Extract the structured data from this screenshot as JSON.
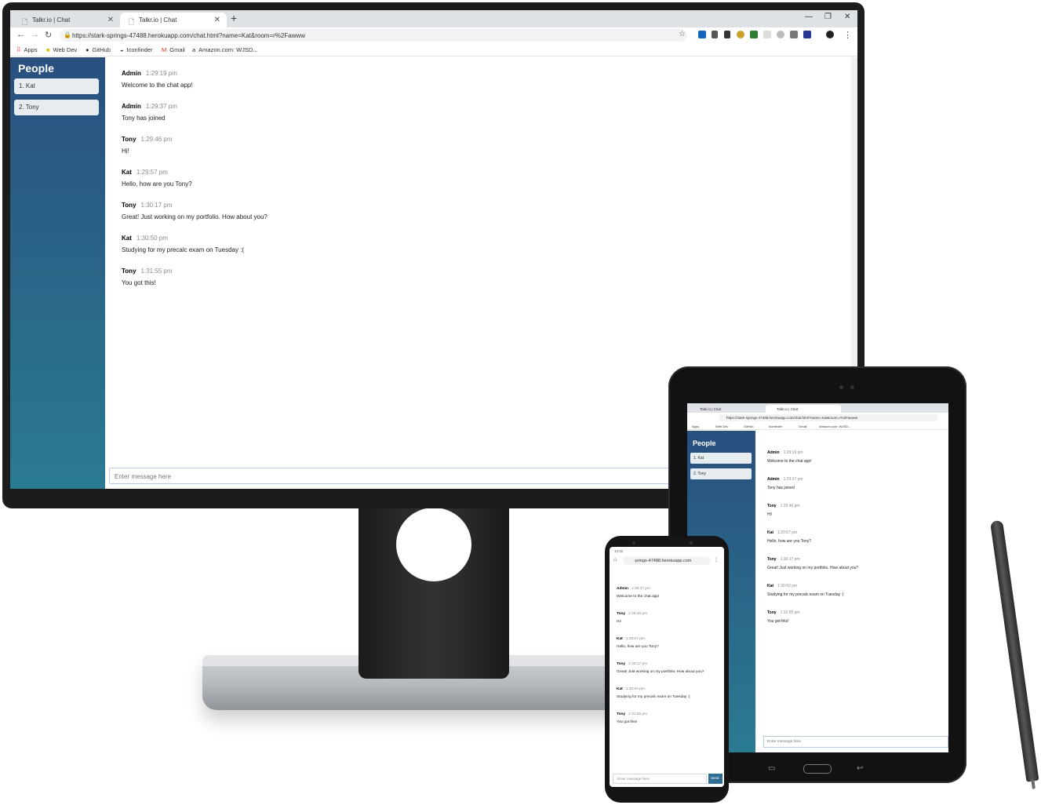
{
  "browser": {
    "tabs": [
      {
        "title": "Talkr.io | Chat"
      },
      {
        "title": "Talkr.io | Chat"
      }
    ],
    "url": "https://stark-springs-47488.herokuapp.com/chat.html?name=Kat&room=r%2Fawww",
    "bookmarks": [
      "Apps",
      "Web Dev",
      "GitHub",
      "Iconfinder",
      "Gmail",
      "Amazon.com: WJSD..."
    ]
  },
  "sidebar": {
    "title": "People",
    "people": [
      "1. Kat",
      "2. Tony"
    ]
  },
  "messages": [
    {
      "from": "Admin",
      "time": "1:29:19 pm",
      "text": "Welcome to the chat app!"
    },
    {
      "from": "Admin",
      "time": "1:29:37 pm",
      "text": "Tony has joined"
    },
    {
      "from": "Tony",
      "time": "1:29:46 pm",
      "text": "Hi!"
    },
    {
      "from": "Kat",
      "time": "1:29:57 pm",
      "text": "Hello, how are you Tony?"
    },
    {
      "from": "Tony",
      "time": "1:30:17 pm",
      "text": "Great! Just working on my portfolio. How about you?"
    },
    {
      "from": "Kat",
      "time": "1:30:50 pm",
      "text": "Studying for my precalc exam on Tuesday :("
    },
    {
      "from": "Tony",
      "time": "1:31:55 pm",
      "text": "You got this!"
    }
  ],
  "composer": {
    "placeholder": "Enter message here"
  },
  "phone": {
    "status_time": "13:32",
    "url": "-prings-47488.herokuapp.com",
    "send_label": "Send",
    "messages": [
      {
        "from": "Admin",
        "time": "1:29:37 pm",
        "text": "Welcome to the chat app!"
      },
      {
        "from": "Tony",
        "time": "1:29:46 pm",
        "text": "Hi!"
      },
      {
        "from": "Kat",
        "time": "1:29:57 pm",
        "text": "Hello, how are you Tony?"
      },
      {
        "from": "Tony",
        "time": "1:30:17 pm",
        "text": "Great! Just working on my portfolio. How about you?"
      },
      {
        "from": "Kat",
        "time": "1:30:50 pm",
        "text": "Studying for my precalc exam on Tuesday :("
      },
      {
        "from": "Tony",
        "time": "1:31:55 pm",
        "text": "You got this!"
      }
    ]
  },
  "colors": {
    "sidebar_top": "#29507f",
    "sidebar_bottom": "#2a7a92",
    "send_button": "#2f6d94"
  }
}
